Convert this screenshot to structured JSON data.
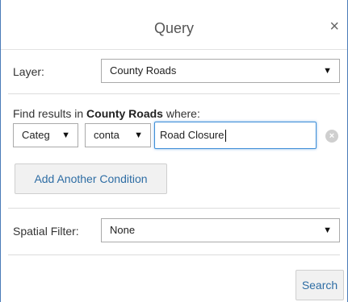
{
  "dialog": {
    "title": "Query",
    "close_glyph": "×"
  },
  "layer": {
    "label": "Layer:",
    "value": "County Roads"
  },
  "conditions": {
    "intro_prefix": "Find results in ",
    "layer_name": "County Roads",
    "intro_suffix": " where:",
    "field_value": "Categ",
    "operator_value": "conta",
    "text_value": "Road Closure",
    "clear_glyph": "×"
  },
  "buttons": {
    "add_condition": "Add Another Condition",
    "search": "Search"
  },
  "spatial_filter": {
    "label": "Spatial Filter:",
    "value": "None"
  },
  "icons": {
    "dropdown_arrow": "▼"
  },
  "colors": {
    "accent": "#2e6da4",
    "focus_border": "#3e8ed8",
    "frame_border": "#4a7bb8"
  }
}
